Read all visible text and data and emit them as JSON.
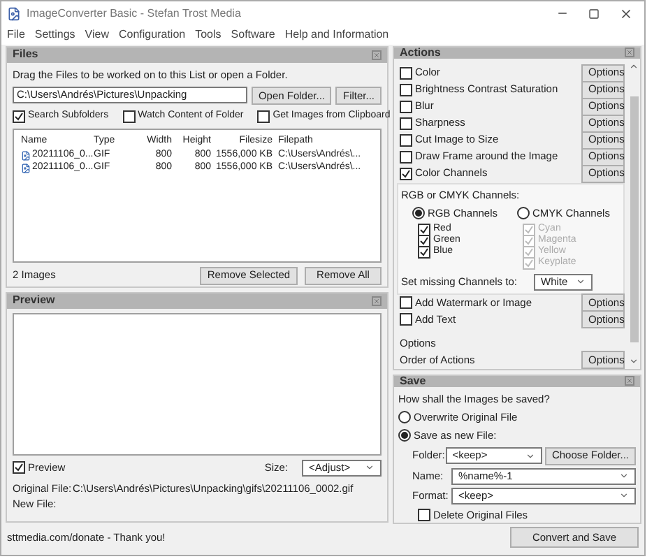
{
  "window": {
    "title": "ImageConverter Basic - Stefan Trost Media"
  },
  "menu": [
    "File",
    "Settings",
    "View",
    "Configuration",
    "Tools",
    "Software",
    "Help and Information"
  ],
  "files": {
    "title": "Files",
    "hint": "Drag the Files to be worked on to this List or open a Folder.",
    "folder": "C:\\Users\\Andrés\\Pictures\\Unpacking",
    "buttons": [
      "Open Folder...",
      "Filter..."
    ],
    "options": [
      {
        "label": "Search Subfolders",
        "checked": true
      },
      {
        "label": "Watch Content of Folder",
        "checked": false
      },
      {
        "label": "Get Images from Clipboard",
        "checked": false
      }
    ],
    "columns": [
      "Name",
      "Type",
      "Width",
      "Height",
      "Filesize",
      "Filepath"
    ],
    "rows": [
      [
        "20211106_0...",
        "GIF",
        "800",
        "800",
        "1556,000 KB",
        "C:\\Users\\Andrés\\..."
      ],
      [
        "20211106_0...",
        "GIF",
        "800",
        "800",
        "1556,000 KB",
        "C:\\Users\\Andrés\\..."
      ]
    ],
    "count": "2 Images",
    "actions": [
      "Remove Selected",
      "Remove All"
    ]
  },
  "preview": {
    "title": "Preview",
    "checkbox": {
      "label": "Preview",
      "checked": true
    },
    "size_label": "Size:",
    "size": "<Adjust>",
    "original_label": "Original File:",
    "original": "C:\\Users\\Andrés\\Pictures\\Unpacking\\gifs\\20211106_0002.gif",
    "new_label": "New File:"
  },
  "status": "sttmedia.com/donate - Thank you!",
  "actions": {
    "title": "Actions",
    "items": [
      {
        "label": "Color",
        "checked": false,
        "button": "Options"
      },
      {
        "label": "Brightness Contrast Saturation",
        "checked": false,
        "button": "Options"
      },
      {
        "label": "Blur",
        "checked": false,
        "button": "Options"
      },
      {
        "label": "Sharpness",
        "checked": false,
        "button": "Options"
      },
      {
        "label": "Cut Image to Size",
        "checked": false,
        "button": "Options"
      },
      {
        "label": "Draw Frame around the Image",
        "checked": false,
        "button": "Options"
      },
      {
        "label": "Color Channels",
        "checked": true,
        "button": "Options"
      }
    ],
    "channels": {
      "heading": "RGB or CMYK Channels:",
      "modes": [
        {
          "label": "RGB Channels",
          "selected": true
        },
        {
          "label": "CMYK Channels",
          "selected": false
        }
      ],
      "rgb": [
        {
          "label": "Red",
          "checked": true,
          "disabled": false
        },
        {
          "label": "Green",
          "checked": true,
          "disabled": false
        },
        {
          "label": "Blue",
          "checked": true,
          "disabled": false
        }
      ],
      "cmyk": [
        {
          "label": "Cyan",
          "checked": true,
          "disabled": true
        },
        {
          "label": "Magenta",
          "checked": true,
          "disabled": true
        },
        {
          "label": "Yellow",
          "checked": true,
          "disabled": true
        },
        {
          "label": "Keyplate",
          "checked": true,
          "disabled": true
        }
      ],
      "missing_label": "Set missing Channels to:",
      "missing": "White"
    },
    "more": [
      {
        "label": "Add Watermark or Image",
        "checked": false,
        "button": "Options"
      },
      {
        "label": "Add Text",
        "checked": false,
        "button": "Options"
      }
    ],
    "options_heading": "Options",
    "order": {
      "label": "Order of Actions",
      "button": "Options"
    }
  },
  "save": {
    "title": "Save",
    "question": "How shall the Images be saved?",
    "modes": [
      {
        "label": "Overwrite Original File",
        "selected": false
      },
      {
        "label": "Save as new File:",
        "selected": true
      }
    ],
    "folder_label": "Folder:",
    "folder": "<keep>",
    "folder_button": "Choose Folder...",
    "name_label": "Name:",
    "name": "%name%-1",
    "format_label": "Format:",
    "format": "<keep>",
    "delete": {
      "label": "Delete Original Files",
      "checked": false
    },
    "convert": "Convert and Save"
  }
}
